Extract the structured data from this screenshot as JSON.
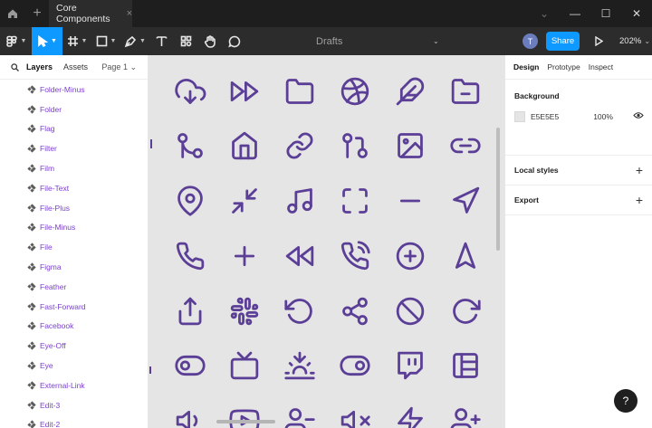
{
  "window": {
    "tab_title": "Core Components",
    "tab_close": "×",
    "new_tab": "+",
    "controls": [
      "⌄",
      "—",
      "☐",
      "✕"
    ]
  },
  "toolbar": {
    "file_name": "Drafts",
    "file_caret": "⌄",
    "avatar_initial": "T",
    "share_label": "Share",
    "zoom_label": "202%",
    "zoom_caret": "⌄",
    "tools": [
      "main-menu",
      "move",
      "frame",
      "shape",
      "pen",
      "text",
      "resources",
      "hand",
      "comment"
    ]
  },
  "left_panel": {
    "tab_layers": "Layers",
    "tab_assets": "Assets",
    "page_label": "Page 1 ⌄",
    "layers": [
      "Folder-Minus",
      "Folder",
      "Flag",
      "Filter",
      "Film",
      "File-Text",
      "File-Plus",
      "File-Minus",
      "File",
      "Figma",
      "Feather",
      "Fast-Forward",
      "Facebook",
      "Eye-Off",
      "Eye",
      "External-Link",
      "Edit-3",
      "Edit-2"
    ]
  },
  "canvas": {
    "background": "#E5E5E5",
    "icon_color": "#5B3E96",
    "icons": [
      "cloud-download-icon",
      "fast-forward-icon",
      "folder-icon",
      "dribbble-icon",
      "feather-icon",
      "folder-minus-icon",
      "git-merge-icon",
      "home-icon",
      "link-icon",
      "git-pull-request-icon",
      "image-icon",
      "link-2-icon",
      "map-pin-icon",
      "minimize-2-icon",
      "music-icon",
      "maximize-icon",
      "minus-icon",
      "navigation-icon",
      "phone-icon",
      "plus-icon",
      "rewind-icon",
      "phone-call-icon",
      "plus-circle-icon",
      "navigation-2-icon",
      "share-icon",
      "slack-icon",
      "rotate-ccw-icon",
      "share-2-icon",
      "slash-icon",
      "rotate-cw-icon",
      "toggle-left-icon",
      "tv-icon",
      "sunset-icon",
      "toggle-right-icon",
      "twitch-icon",
      "sidebar-icon",
      "volume-icon",
      "youtube-icon",
      "user-minus-icon",
      "volume-x-icon",
      "zap-icon",
      "user-plus-icon"
    ]
  },
  "right_panel": {
    "tabs": [
      "Design",
      "Prototype",
      "Inspect"
    ],
    "background_title": "Background",
    "background_hex": "E5E5E5",
    "background_opacity": "100%",
    "local_styles": "Local styles",
    "export": "Export",
    "add": "+"
  },
  "help_label": "?"
}
